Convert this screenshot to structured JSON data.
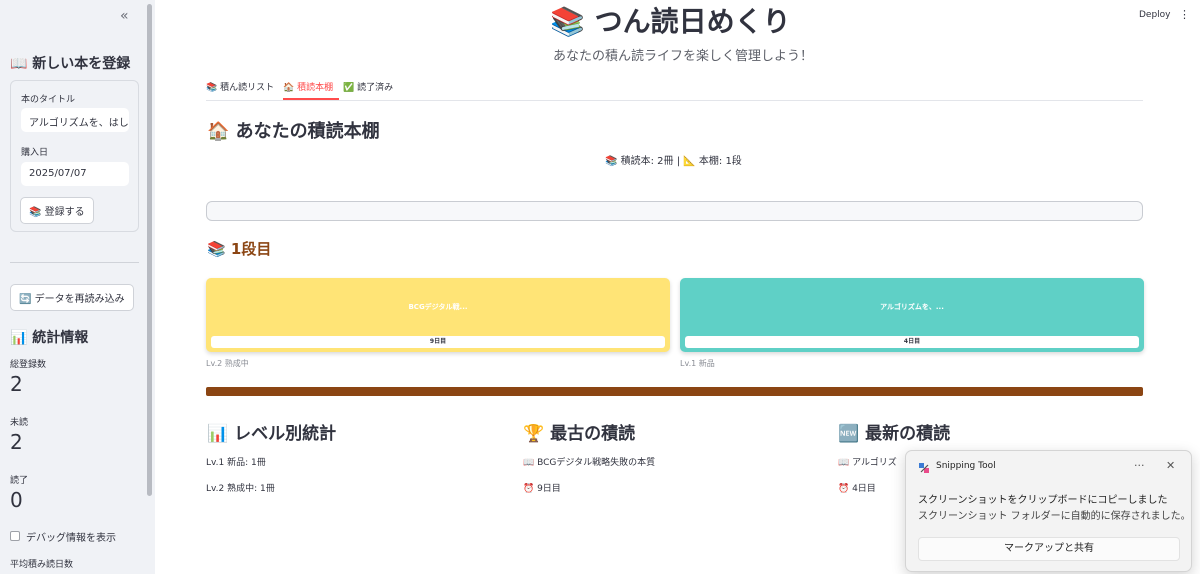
{
  "sidebar": {
    "collapse_icon": "«",
    "register_heading": "📖 新しい本を登録",
    "title_label": "本のタイトル",
    "title_value": "アルゴリズムを、はし",
    "date_label": "購入日",
    "date_value": "2025/07/07",
    "register_button": "📚 登録する",
    "reload_button": "🔄 データを再読み込み",
    "stats_heading": "📊 統計情報",
    "metrics": [
      {
        "label": "総登録数",
        "value": "2"
      },
      {
        "label": "未読",
        "value": "2"
      },
      {
        "label": "読了",
        "value": "0"
      }
    ],
    "debug_label": "デバッグ情報を表示",
    "avg_label": "平均積み読日数"
  },
  "header": {
    "deploy": "Deploy",
    "menu_icon": "⋮"
  },
  "main": {
    "title": "📚 つん読日めくり",
    "subtitle": "あなたの積ん読ライフを楽しく管理しよう！",
    "tabs": [
      {
        "label": "📚 積ん読リスト"
      },
      {
        "label": "🏠 積読本棚",
        "active": true
      },
      {
        "label": "✅ 読了済み"
      }
    ],
    "shelf_title": "🏠 あなたの積読本棚",
    "shelf_summary": "📚 積読本: 2冊 | 📐 本棚: 1段",
    "level_title": "📚 1段目",
    "books": [
      {
        "title": "BCGデジタル戦...",
        "days": "9日目",
        "caption": "Lv.2 熟成中",
        "color": "#ffe476"
      },
      {
        "title": "アルゴリズムを、...",
        "days": "4日目",
        "caption": "Lv.1 新品",
        "color": "#5fd0c6"
      }
    ],
    "shelf_board_color": "#8b4513",
    "stats": {
      "level_title": "📊 レベル別統計",
      "level_lines": [
        "Lv.1 新品: 1冊",
        "Lv.2 熟成中: 1冊"
      ],
      "oldest_title": "🏆 最古の積読",
      "oldest_book": "📖 BCGデジタル戦略失敗の本質",
      "oldest_days": "⏰ 9日目",
      "newest_title": "🆕 最新の積読",
      "newest_book": "📖 アルゴリズ",
      "newest_days": "⏰ 4日目"
    }
  },
  "toast": {
    "app_name": "Snipping Tool",
    "more_icon": "···",
    "close_icon": "✕",
    "line1": "スクリーンショットをクリップボードにコピーしました",
    "line2": "スクリーンショット フォルダーに自動的に保存されました。",
    "button": "マークアップと共有"
  }
}
